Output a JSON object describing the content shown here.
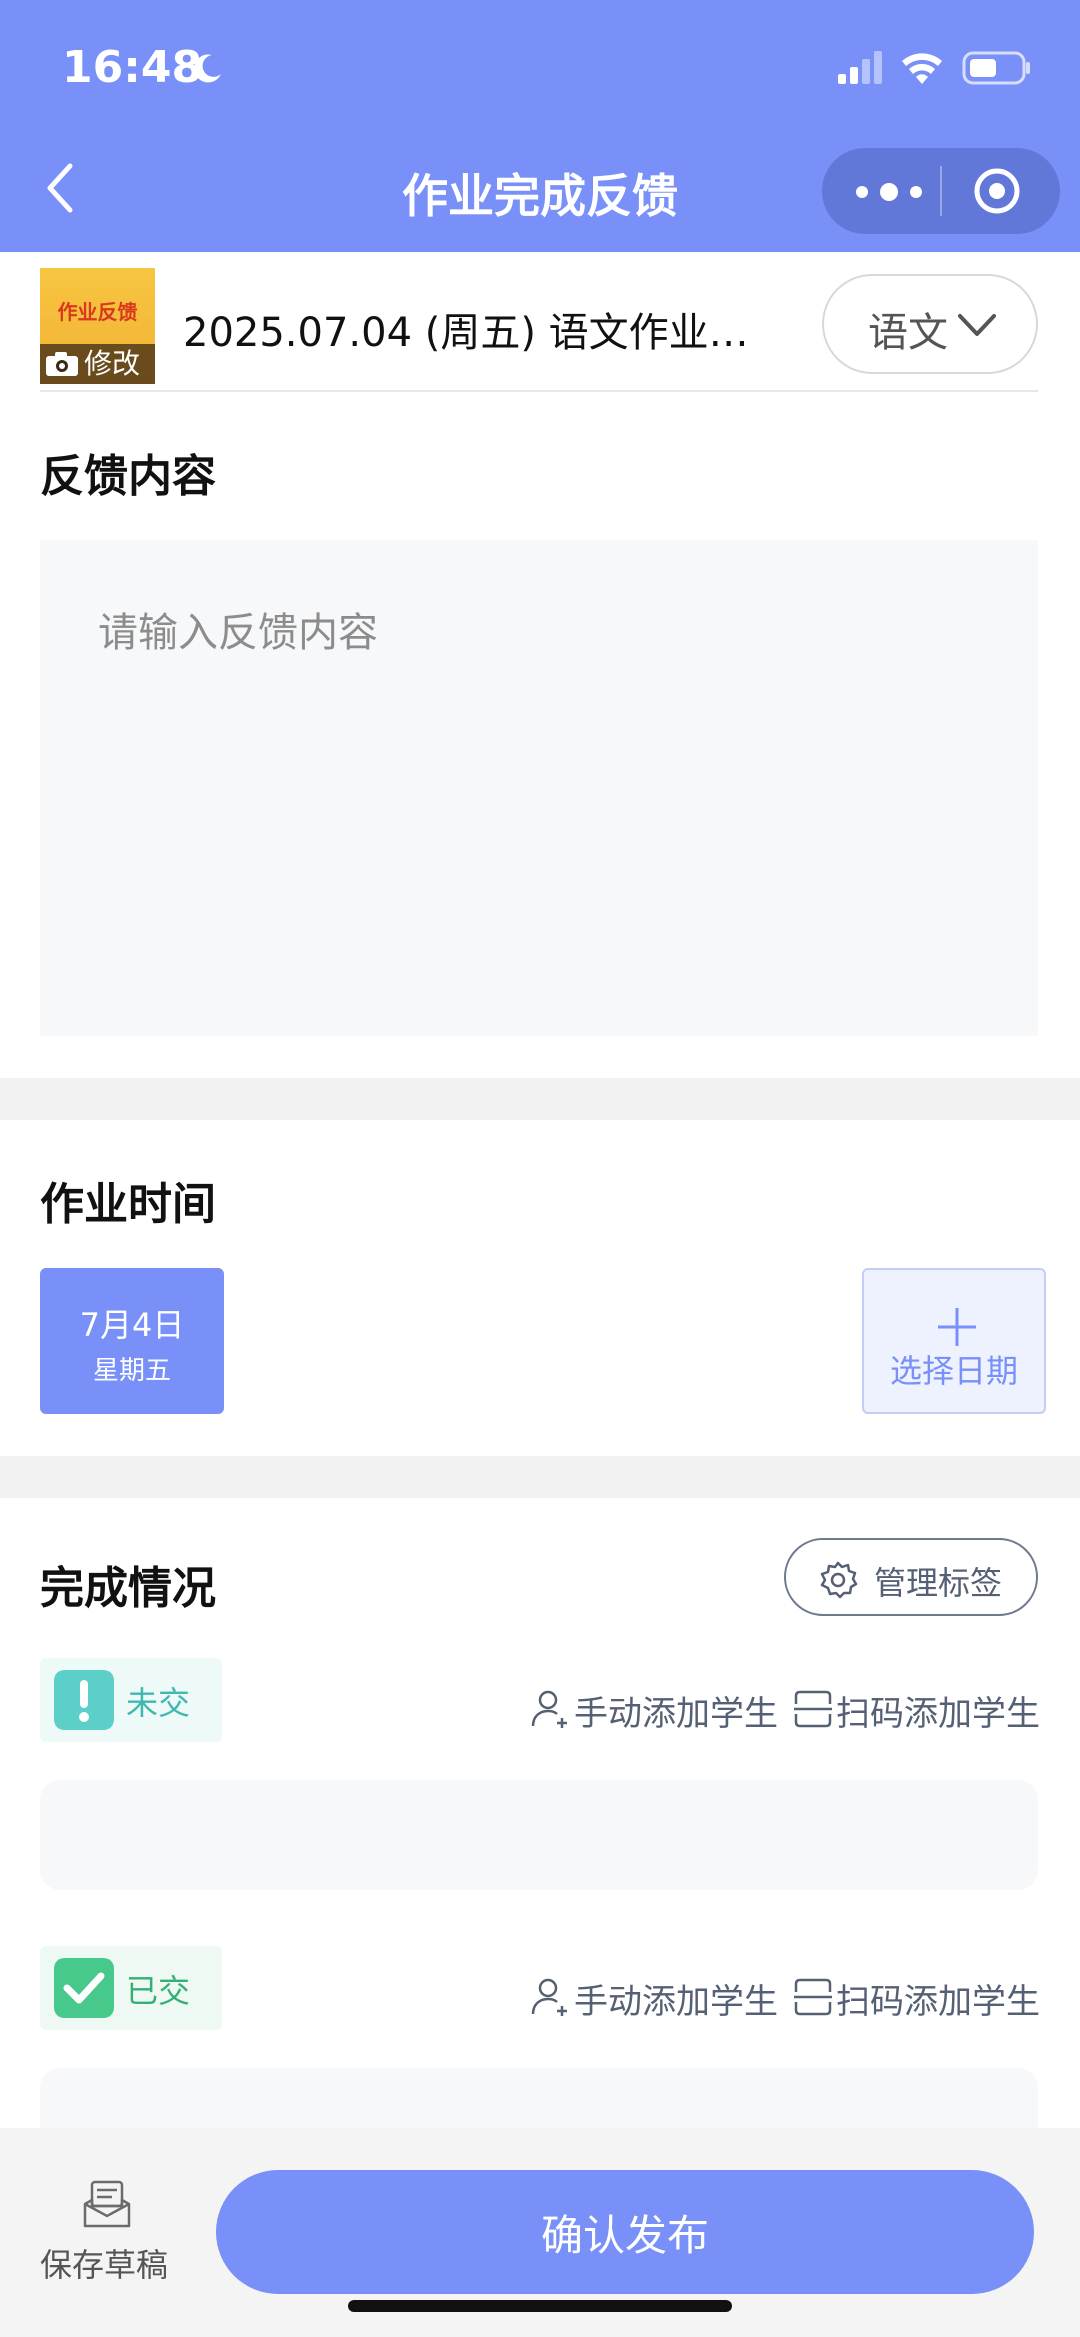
{
  "status_bar": {
    "time": "16:48"
  },
  "nav": {
    "title": "作业完成反馈"
  },
  "homework": {
    "thumb_text": "作业反馈",
    "thumb_edit_label": "修改",
    "title": "2025.07.04 (周五) 语文作业…",
    "subject": "语文"
  },
  "feedback": {
    "title": "反馈内容",
    "placeholder": "请输入反馈内容"
  },
  "homework_time": {
    "title": "作业时间",
    "selected_day": "7月4日",
    "selected_weekday": "星期五",
    "choose_date_label": "选择日期"
  },
  "completion": {
    "title": "完成情况",
    "manage_tags_label": "管理标签",
    "groups": [
      {
        "label": "未交",
        "manual_add": "手动添加学生",
        "scan_add": "扫码添加学生"
      },
      {
        "label": "已交",
        "manual_add": "手动添加学生",
        "scan_add": "扫码添加学生"
      }
    ]
  },
  "bottom": {
    "save_draft_label": "保存草稿",
    "publish_label": "确认发布"
  },
  "colors": {
    "primary": "#7890f7",
    "not_submitted": "#5ccfc9",
    "submitted": "#46c98a"
  }
}
